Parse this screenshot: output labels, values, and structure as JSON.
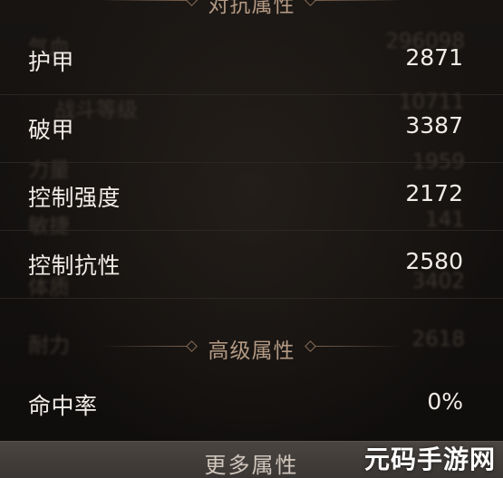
{
  "sections": {
    "resistance": {
      "title": "对抗属性"
    },
    "advanced": {
      "title": "高级属性"
    }
  },
  "stats": [
    {
      "label": "护甲",
      "value": "2871"
    },
    {
      "label": "破甲",
      "value": "3387"
    },
    {
      "label": "控制强度",
      "value": "2172"
    },
    {
      "label": "控制抗性",
      "value": "2580"
    }
  ],
  "advanced_stats": [
    {
      "label": "命中率",
      "value": "0%"
    }
  ],
  "ghost_rows": [
    {
      "label": "气血",
      "value": "296098"
    },
    {
      "label": "战斗等级",
      "value": "10711"
    },
    {
      "label": "力量",
      "value": "1959"
    },
    {
      "label": "敏捷",
      "value": "141"
    },
    {
      "label": "体质",
      "value": "3402"
    },
    {
      "label": "耐力",
      "value": "2618"
    }
  ],
  "footer": {
    "more_label": "更多属性"
  },
  "watermark": "元码手游网",
  "colors": {
    "background": "#131110",
    "text": "#f2ece6",
    "header_text": "#b49a84",
    "divider": "#2b2622",
    "footer_bar": "#4a4541"
  }
}
